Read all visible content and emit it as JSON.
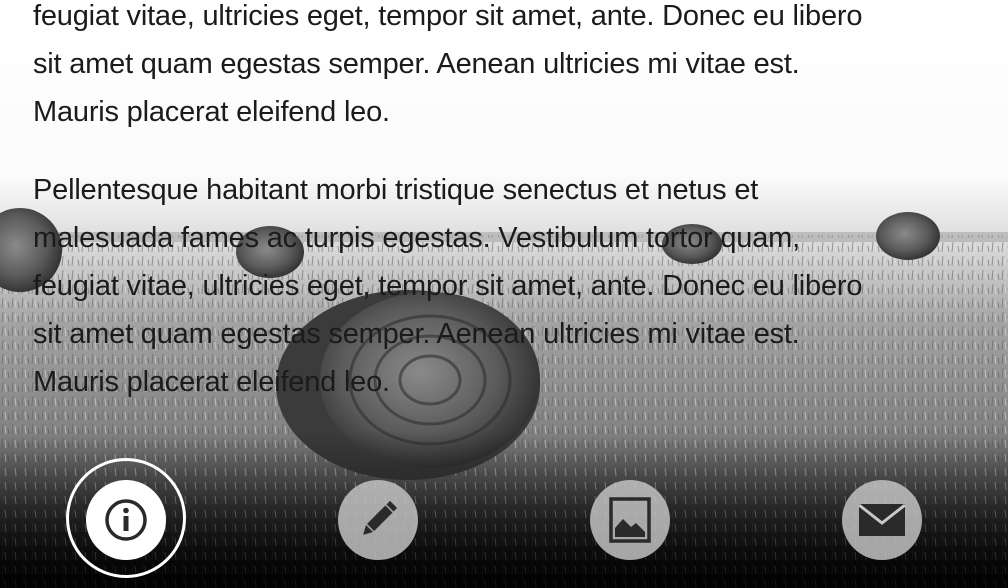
{
  "content": {
    "paragraph_1_lines": [
      "feugiat vitae, ultricies eget, tempor sit amet, ante. Donec eu libero",
      "sit amet quam egestas semper. Aenean ultricies mi vitae est.",
      "Mauris placerat eleifend leo."
    ],
    "paragraph_2_lines": [
      "Pellentesque habitant morbi tristique senectus et netus et",
      "malesuada fames ac turpis egestas. Vestibulum tortor quam,",
      "feugiat vitae, ultricies eget, tempor sit amet, ante. Donec eu libero",
      "sit amet quam egestas semper. Aenean ultricies mi vitae est.",
      "Mauris placerat eleifend leo."
    ]
  },
  "nav": {
    "items": [
      {
        "icon": "info-icon",
        "active": true
      },
      {
        "icon": "pencil-icon",
        "active": false
      },
      {
        "icon": "image-icon",
        "active": false
      },
      {
        "icon": "mail-icon",
        "active": false
      }
    ]
  },
  "colors": {
    "text": "#1b1b1b",
    "nav_button": "#c8c8c8",
    "nav_active": "#ffffff",
    "icon": "#2a2a2a"
  }
}
